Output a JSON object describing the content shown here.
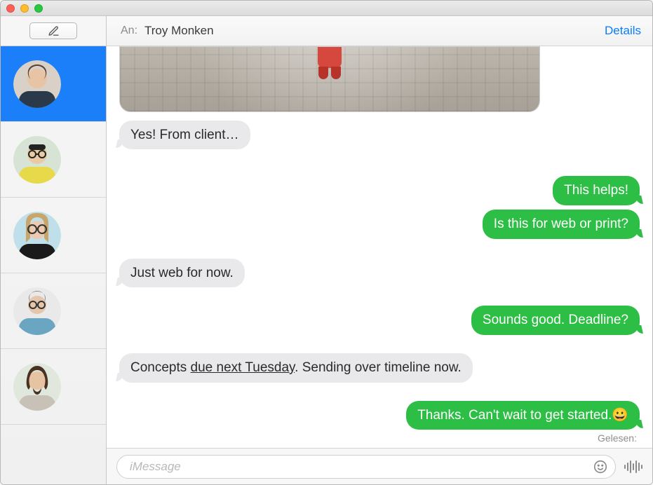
{
  "header": {
    "to_label": "An:",
    "recipient": "Troy Monken",
    "details_label": "Details"
  },
  "sidebar": {
    "conversations": [
      {
        "selected": true
      },
      {
        "selected": false
      },
      {
        "selected": false
      },
      {
        "selected": false
      },
      {
        "selected": false
      }
    ]
  },
  "messages": [
    {
      "side": "left",
      "style": "gray",
      "text": "Yes! From client…"
    },
    {
      "side": "right",
      "style": "green",
      "text": "This helps!"
    },
    {
      "side": "right",
      "style": "green",
      "text": "Is this for web or print?"
    },
    {
      "side": "left",
      "style": "gray",
      "text": "Just web for now."
    },
    {
      "side": "right",
      "style": "green",
      "text": "Sounds good. Deadline?"
    },
    {
      "side": "left",
      "style": "gray",
      "text_prefix": "Concepts ",
      "text_underline": "due next Tuesday",
      "text_suffix": ". Sending over timeline now."
    },
    {
      "side": "right",
      "style": "green",
      "text": "Thanks. Can't wait to get started.😀"
    }
  ],
  "receipt": {
    "label": "Gelesen:"
  },
  "inputbar": {
    "placeholder": "iMessage",
    "value": ""
  }
}
